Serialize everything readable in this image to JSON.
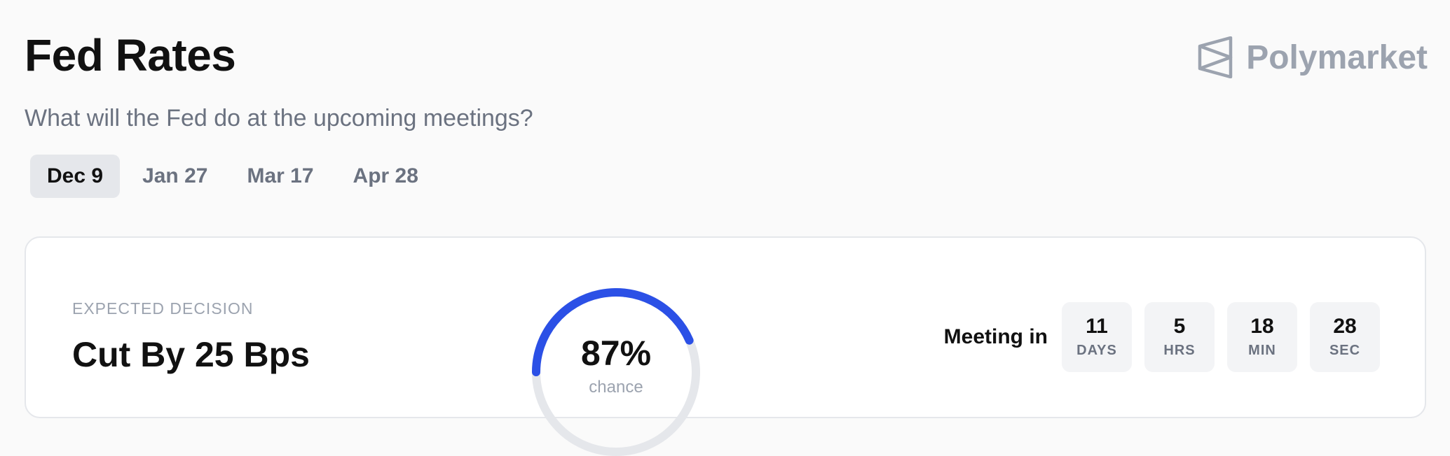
{
  "header": {
    "title": "Fed Rates",
    "subtitle": "What will the Fed do at the upcoming meetings?"
  },
  "brand": {
    "name": "Polymarket",
    "icon": "polymarket-logo-icon",
    "color": "#9ca3af"
  },
  "tabs": [
    {
      "label": "Dec 9",
      "active": true
    },
    {
      "label": "Jan 27",
      "active": false
    },
    {
      "label": "Mar 17",
      "active": false
    },
    {
      "label": "Apr 28",
      "active": false
    }
  ],
  "card": {
    "label": "EXPECTED DECISION",
    "decision": "Cut By 25 Bps",
    "probability": {
      "value_text": "87%",
      "fraction": 0.87,
      "sub_text": "chance",
      "accent_color": "#2b50e6",
      "track_color": "#e5e7eb"
    },
    "meeting": {
      "label": "Meeting in",
      "countdown": [
        {
          "value": "11",
          "unit": "DAYS"
        },
        {
          "value": "5",
          "unit": "HRS"
        },
        {
          "value": "18",
          "unit": "MIN"
        },
        {
          "value": "28",
          "unit": "SEC"
        }
      ]
    }
  }
}
